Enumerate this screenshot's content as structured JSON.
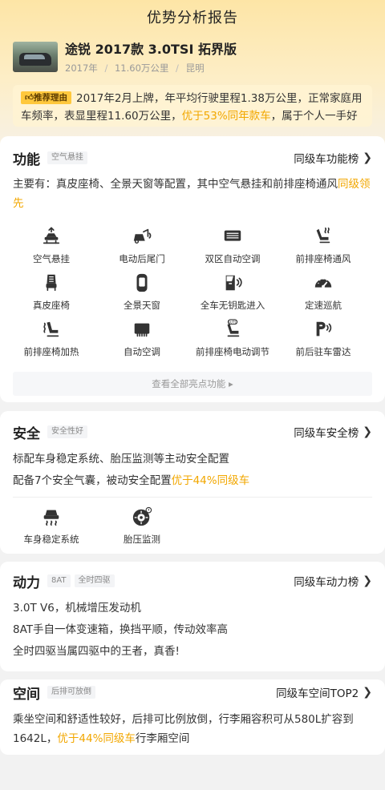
{
  "page_title": "优势分析报告",
  "car": {
    "name": "途锐 2017款 3.0TSI 拓界版",
    "year": "2017年",
    "mileage": "11.60万公里",
    "city": "昆明",
    "sep": "/"
  },
  "reason": {
    "tag": "推荐理由",
    "text_before": "2017年2月上牌，年平均行驶里程1.38万公里，正常家庭用车频率，表显里程11.60万公里，",
    "highlight": "优于53%同年款车",
    "text_after": "，属于个人一手好车"
  },
  "function_section": {
    "title": "功能",
    "chip": "空气悬挂",
    "rank_label": "同级车功能榜",
    "desc_before": "主要有：真皮座椅、全景天窗等配置，其中空气悬挂和前排座椅通风",
    "desc_highlight": "同级领先",
    "features": [
      {
        "label": "空气悬挂",
        "icon": "air-suspension-icon"
      },
      {
        "label": "电动后尾门",
        "icon": "power-tailgate-icon"
      },
      {
        "label": "双区自动空调",
        "icon": "dual-zone-ac-icon"
      },
      {
        "label": "前排座椅通风",
        "icon": "seat-ventilation-icon"
      },
      {
        "label": "真皮座椅",
        "icon": "leather-seat-icon"
      },
      {
        "label": "全景天窗",
        "icon": "panoramic-sunroof-icon"
      },
      {
        "label": "全车无钥匙进入",
        "icon": "keyless-entry-icon"
      },
      {
        "label": "定速巡航",
        "icon": "cruise-control-icon"
      },
      {
        "label": "前排座椅加热",
        "icon": "seat-heating-icon"
      },
      {
        "label": "自动空调",
        "icon": "auto-ac-icon"
      },
      {
        "label": "前排座椅电动调节",
        "icon": "power-seat-adjust-icon"
      },
      {
        "label": "前后驻车雷达",
        "icon": "parking-radar-icon"
      }
    ],
    "more_label": "查看全部亮点功能",
    "more_arrow": "▸"
  },
  "safety_section": {
    "title": "安全",
    "chip": "安全性好",
    "rank_label": "同级车安全榜",
    "line1": "标配车身稳定系统、胎压监测等主动安全配置",
    "line2_before": "配备7个安全气囊，被动安全配置",
    "line2_highlight": "优于44%同级车",
    "features": [
      {
        "label": "车身稳定系统",
        "icon": "stability-control-icon"
      },
      {
        "label": "胎压监测",
        "icon": "tire-pressure-icon"
      }
    ]
  },
  "power_section": {
    "title": "动力",
    "chips": [
      "8AT",
      "全时四驱"
    ],
    "rank_label": "同级车动力榜",
    "lines": [
      "3.0T V6，机械增压发动机",
      "8AT手自一体变速箱，换挡平顺，传动效率高",
      "全时四驱当属四驱中的王者，真香!"
    ]
  },
  "space_section": {
    "title": "空间",
    "chip": "后排可放倒",
    "rank_label": "同级车空间TOP2",
    "text_before": "乘坐空间和舒适性较好，后排可比例放倒，行李厢容积可从580L扩容到1642L，",
    "highlight": "优于44%同级车",
    "text_after": "行李厢空间"
  },
  "colors": {
    "highlight": "#f2a700",
    "tag_bg": "#ffc83d",
    "hero_top": "#fde5a6"
  }
}
